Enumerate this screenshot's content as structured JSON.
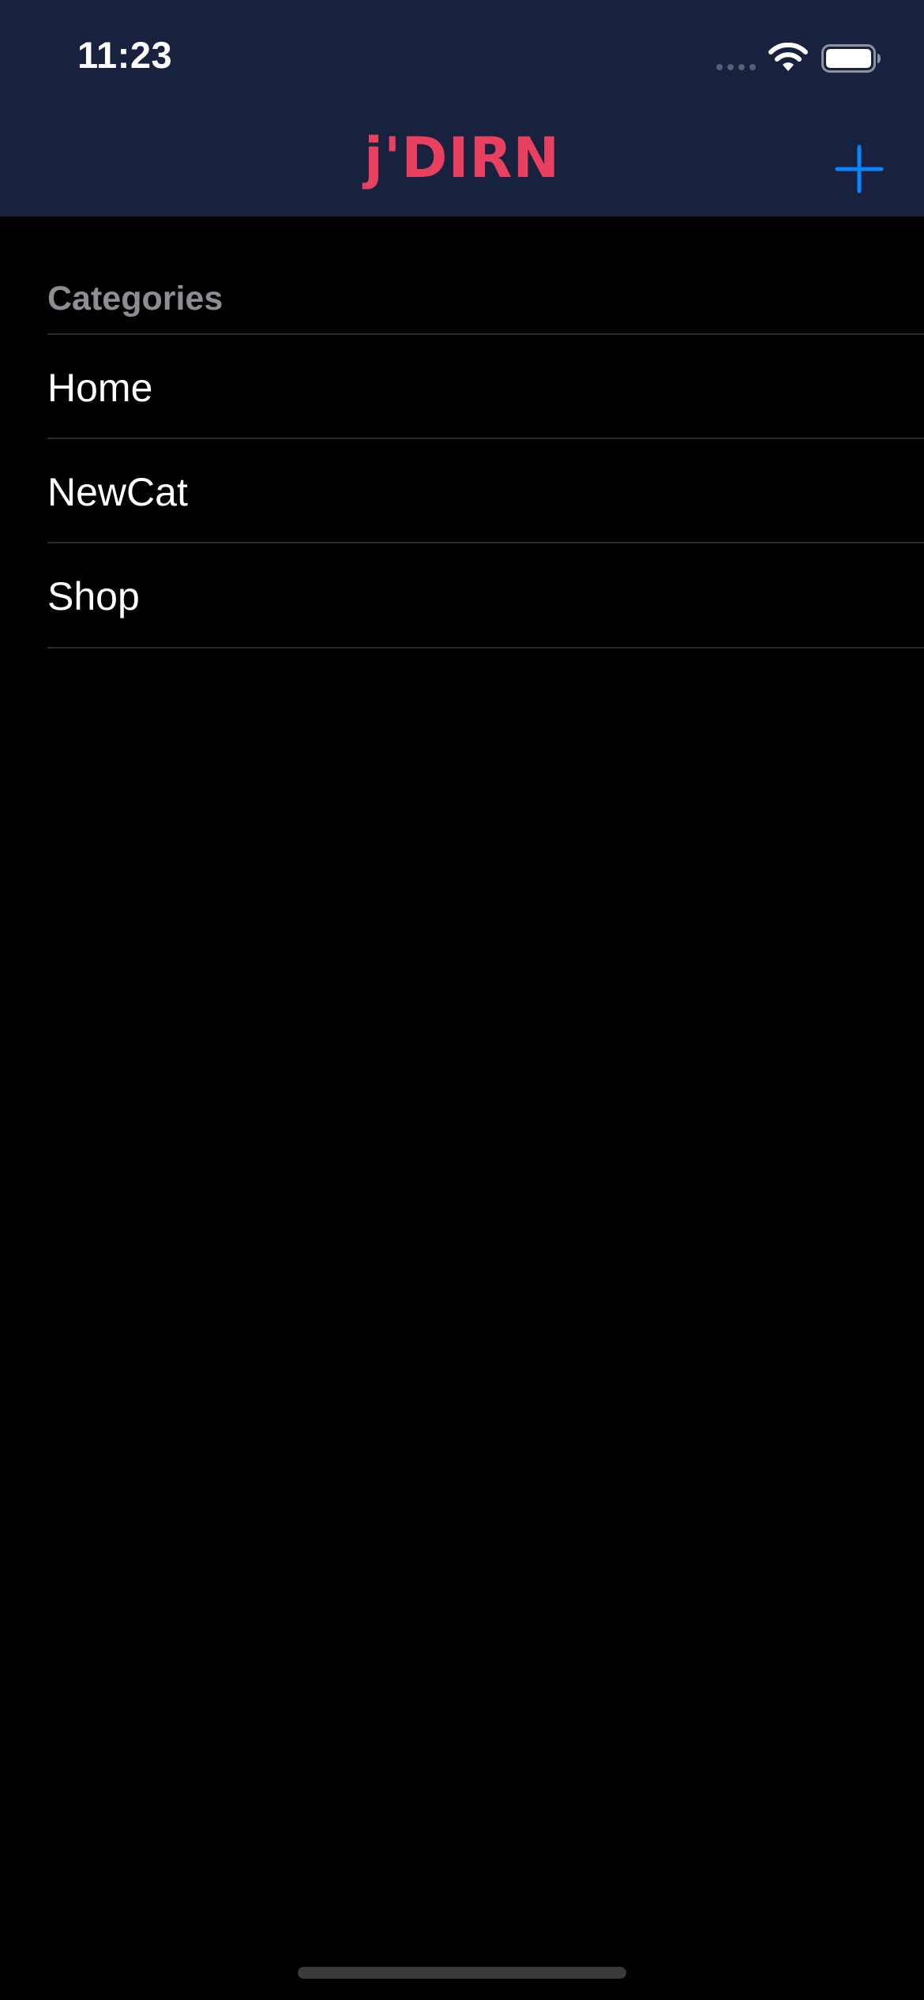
{
  "status_bar": {
    "time": "11:23",
    "signal_icon": "signal-dots-icon",
    "wifi_icon": "wifi-icon",
    "battery_icon": "battery-icon"
  },
  "nav": {
    "logo_text": "j'DIRN",
    "add_icon": "plus-icon"
  },
  "list": {
    "section_header": "Categories",
    "items": [
      {
        "label": "Home"
      },
      {
        "label": "NewCat"
      },
      {
        "label": "Shop"
      }
    ]
  },
  "colors": {
    "nav_background": "#18213d",
    "logo": "#e8405e",
    "accent": "#0a84ff",
    "background": "#000000",
    "header_text": "#8d8d93",
    "separator": "#2a2a2d"
  }
}
